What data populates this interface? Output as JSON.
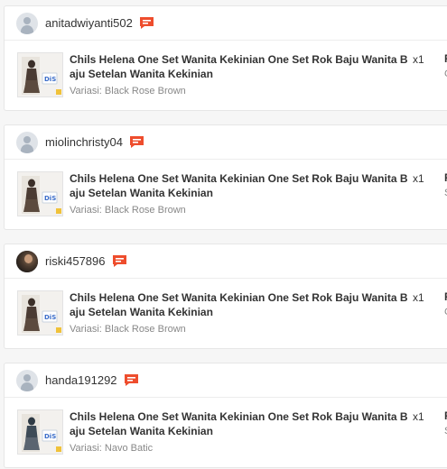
{
  "orders": [
    {
      "username": "anitadwiyanti502",
      "avatar": "default-avatar-icon",
      "product_title": "Chils Helena One Set Wanita Kekinian One Set Rok Baju Wanita Baju Setelan Wanita Kekinian",
      "quantity": "x1",
      "variant": "Variasi: Black Rose Brown",
      "col_head": "R",
      "col_sub": "C"
    },
    {
      "username": "miolinchristy04",
      "avatar": "default-avatar-icon",
      "product_title": "Chils Helena One Set Wanita Kekinian One Set Rok Baju Wanita Baju Setelan Wanita Kekinian",
      "quantity": "x1",
      "variant": "Variasi: Black Rose Brown",
      "col_head": "R",
      "col_sub": "S"
    },
    {
      "username": "riski457896",
      "avatar": "photo-avatar",
      "product_title": "Chils Helena One Set Wanita Kekinian One Set Rok Baju Wanita Baju Setelan Wanita Kekinian",
      "quantity": "x1",
      "variant": "Variasi: Black Rose Brown",
      "col_head": "R",
      "col_sub": "C"
    },
    {
      "username": "handa191292",
      "avatar": "default-avatar-icon",
      "product_title": "Chils Helena One Set Wanita Kekinian One Set Rok Baju Wanita Baju Setelan Wanita Kekinian",
      "quantity": "x1",
      "variant": "Variasi: Navo Batic",
      "col_head": "R",
      "col_sub": "S"
    }
  ],
  "colors": {
    "chat_icon": "#ee4d2d",
    "background": "#f6f6f6",
    "card": "#ffffff"
  },
  "icons": {
    "chat": "chat-icon",
    "product": "product-thumbnail"
  }
}
